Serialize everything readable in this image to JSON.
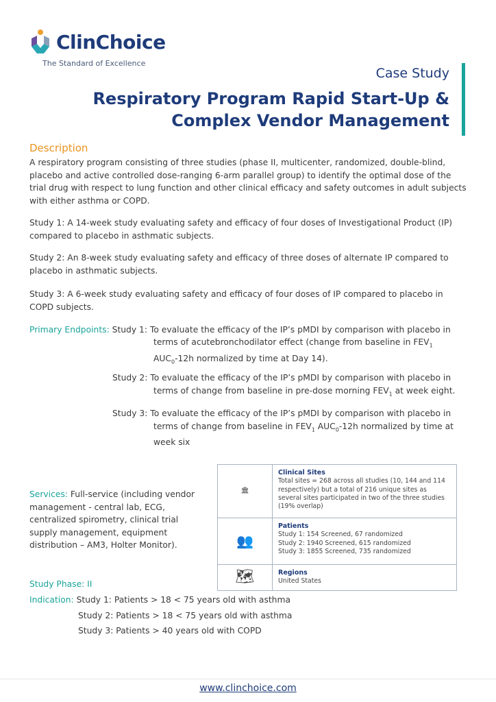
{
  "header": {
    "logo_text": "ClinChoice",
    "tagline": "The Standard of Excellence",
    "doc_type": "Case Study",
    "title_line1": "Respiratory Program Rapid Start-Up &",
    "title_line2": "Complex Vendor Management"
  },
  "description": {
    "heading": "Description",
    "intro": "A respiratory program consisting of three studies (phase II, multicenter, randomized, double-blind, placebo and active controlled dose-ranging 6-arm parallel group) to identify the optimal dose of the trial drug with respect to lung function and other clinical efficacy and safety outcomes in adult subjects with either asthma or COPD.",
    "study1": "Study 1: A 14-week study evaluating safety and efficacy of four doses of Investigational Product (IP) compared to placebo in asthmatic subjects.",
    "study2": "Study 2: An 8-week study evaluating safety and efficacy of three doses of alternate IP compared to placebo in asthmatic subjects.",
    "study3": "Study 3: A 6-week study evaluating safety and efficacy of four doses of IP compared to placebo in COPD subjects."
  },
  "endpoints": {
    "label": "Primary Endpoints:",
    "s1a": "Study 1: To evaluate the efficacy of the IP’s pMDI by comparison with placebo in",
    "s1b": "terms of acutebronchodilator effect (change from baseline in FEV",
    "s1c": "AUC",
    "s1d": "-12h normalized by time at Day 14).",
    "s2a": "Study 2: To evaluate the efficacy of the IP’s pMDI by comparison with placebo in",
    "s2b": "terms of change from baseline in pre-dose morning FEV",
    "s2c": " at week eight.",
    "s3a": "Study 3: To evaluate the efficacy of the IP’s pMDI by comparison with placebo in",
    "s3b": "terms of change from baseline in FEV",
    "s3c": " AUC",
    "s3d": "-12h normalized by time at",
    "s3e": "week six",
    "sub1": "1",
    "sub0": "0"
  },
  "services": {
    "label": "Services:",
    "text": " Full-service (including vendor management - central lab, ECG, centralized spirometry, clinical trial supply management, equipment distribution – AM3, Holter Monitor)."
  },
  "phase": {
    "label": "Study Phase: II"
  },
  "indication": {
    "label": "Indication:",
    "s1": "Study 1: Patients > 18 < 75 years old with asthma",
    "s2": "Study 2: Patients > 18 < 75 years old with asthma",
    "s3": "Study 3: Patients > 40 years old with COPD"
  },
  "info_box": {
    "sites_title": "Clinical Sites",
    "sites_text": "Total sites = 268 across all studies (10, 144 and 114 respectively) but a total of 216 unique sites as several sites participated in two of the three studies (19% overlap)",
    "patients_title": "Patients",
    "p1": "Study 1: 154 Screened, 67 randomized",
    "p2": "Study 2: 1940 Screened, 615 randomized",
    "p3": "Study 3: 1855 Screened, 735 randomized",
    "regions_title": "Regions",
    "regions_text": "United States"
  },
  "footer": {
    "url": "www.clinchoice.com"
  },
  "colors": {
    "brand": "#1e3b7a",
    "accent_orange": "#e8931e",
    "accent_teal": "#1aa39a"
  }
}
